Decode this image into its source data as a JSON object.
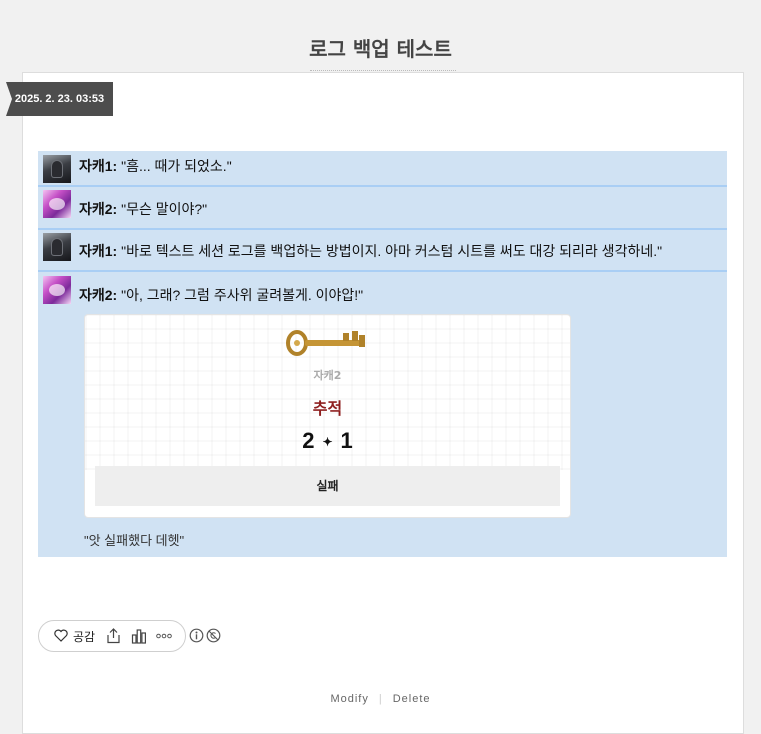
{
  "page": {
    "title": "로그 백업 테스트"
  },
  "post": {
    "date": "2025. 2. 23. 03:53"
  },
  "log": {
    "messages": [
      {
        "speaker": "자캐1:",
        "text": "\"흠... 때가 되었소.\"",
        "avatar": "character-1"
      },
      {
        "speaker": "자캐2:",
        "text": "\"무슨 말이야?\"",
        "avatar": "character-2"
      },
      {
        "speaker": "자캐1:",
        "text": "\"바로 텍스트 세션 로그를 백업하는 방법이지. 아마 커스텀 시트를 써도 대강 되리라 생각하네.\"",
        "avatar": "character-1"
      },
      {
        "speaker": "자캐2:",
        "text": "\"아, 그래? 그럼 주사위 굴려볼게. 이야압!\"",
        "avatar": "character-2"
      }
    ],
    "dice": {
      "icon": "key-icon",
      "user": "자캐2",
      "skill": "추적",
      "target": "2",
      "separator": "✦",
      "roll": "1",
      "outcome": "실패",
      "skill_color": "#8e1e1e"
    },
    "followup": "\"앗 실패했다 데헷\""
  },
  "actions": {
    "like_label": "공감",
    "icons": [
      "heart-icon",
      "share-icon",
      "stats-icon",
      "more-icon",
      "info-icon",
      "no-copy-icon"
    ]
  },
  "footer": {
    "modify": "Modify",
    "delete": "Delete",
    "separator": "|"
  },
  "colors": {
    "log_bg": "#d0e2f3",
    "separator": "#a9cef4",
    "date_tag": "#4d4d4d"
  }
}
